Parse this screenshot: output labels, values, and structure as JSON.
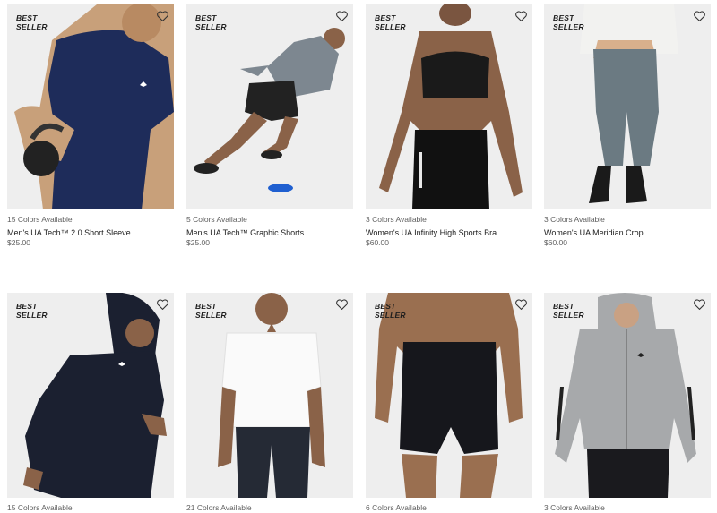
{
  "products": [
    {
      "badge": [
        "BEST",
        "SELLER"
      ],
      "colors": "15 Colors Available",
      "name": "Men's UA Tech™ 2.0 Short Sleeve",
      "price": "$25.00",
      "image": "man-navy-tshirt-kettlebell",
      "bg": "#f0f0f0"
    },
    {
      "badge": [
        "BEST",
        "SELLER"
      ],
      "colors": "5 Colors Available",
      "name": "Men's UA Tech™ Graphic Shorts",
      "price": "$25.00",
      "image": "man-running-shorts-hoodie",
      "bg": "#f0f0f0"
    },
    {
      "badge": [
        "BEST",
        "SELLER"
      ],
      "colors": "3 Colors Available",
      "name": "Women's UA Infinity High Sports Bra",
      "price": "$60.00",
      "image": "woman-sports-bra-leggings",
      "bg": "#f0f0f0"
    },
    {
      "badge": [
        "BEST",
        "SELLER"
      ],
      "colors": "3 Colors Available",
      "name": "Women's UA Meridian Crop",
      "price": "$60.00",
      "image": "woman-gray-crop-leggings",
      "bg": "#f0f0f0"
    },
    {
      "badge": [
        "BEST",
        "SELLER"
      ],
      "colors": "15 Colors Available",
      "name": "",
      "price": "",
      "image": "man-black-hoodie-running",
      "bg": "#f0f0f0"
    },
    {
      "badge": [
        "BEST",
        "SELLER"
      ],
      "colors": "21 Colors Available",
      "name": "",
      "price": "",
      "image": "man-white-polo",
      "bg": "#f0f0f0"
    },
    {
      "badge": [
        "BEST",
        "SELLER"
      ],
      "colors": "6 Colors Available",
      "name": "",
      "price": "",
      "image": "man-boxer-briefs",
      "bg": "#f0f0f0"
    },
    {
      "badge": [
        "BEST",
        "SELLER"
      ],
      "colors": "3 Colors Available",
      "name": "",
      "price": "",
      "image": "woman-gray-zip-hoodie",
      "bg": "#f0f0f0"
    }
  ],
  "wishlist_icon": "heart-outline-icon"
}
